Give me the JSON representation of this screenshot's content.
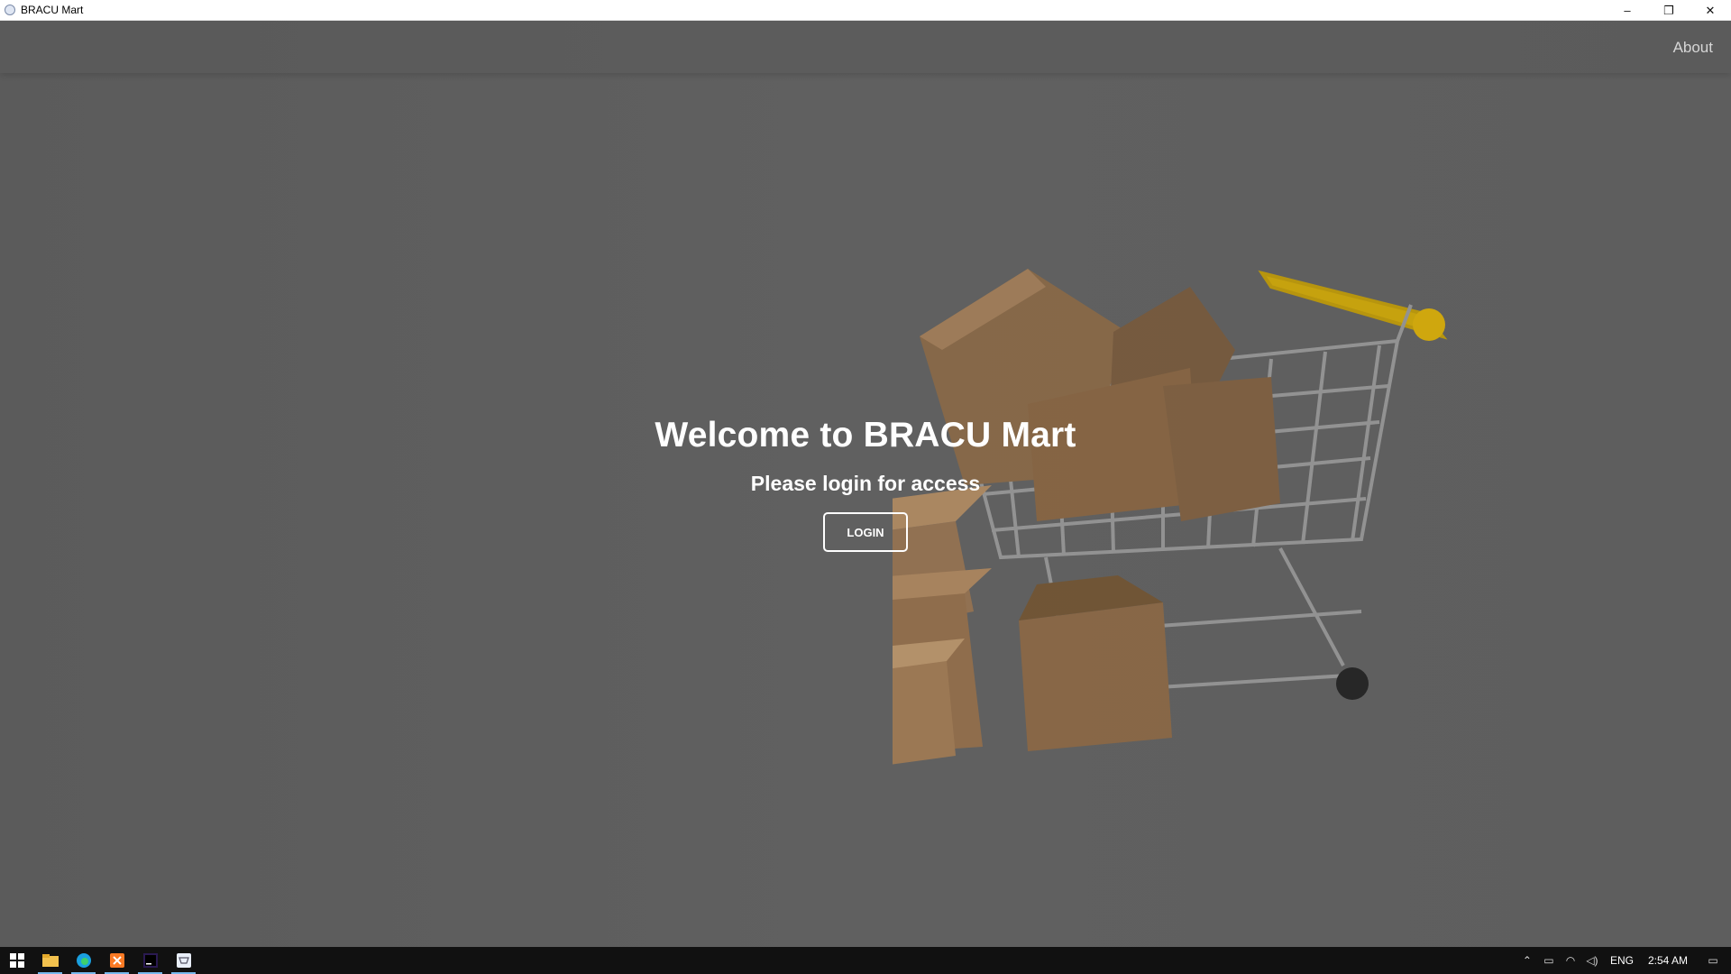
{
  "window": {
    "title": "BRACU Mart",
    "minimize": "–",
    "restore": "❐",
    "close": "✕"
  },
  "nav": {
    "about_label": "About"
  },
  "hero": {
    "title": "Welcome to BRACU Mart",
    "subtitle": "Please login for access",
    "login_label": "LOGIN"
  },
  "taskbar": {
    "apps": [
      "start-icon",
      "file-explorer-icon",
      "edge-browser-icon",
      "xampp-icon",
      "phpstorm-icon",
      "bracu-mart-app-icon"
    ],
    "language": "ENG",
    "time": "2:54 AM"
  },
  "colors": {
    "overlay": "#5e5e5e",
    "text": "#ffffff",
    "taskbar": "#111111",
    "cart_handle": "#e3b400",
    "box": "#9c7246"
  }
}
